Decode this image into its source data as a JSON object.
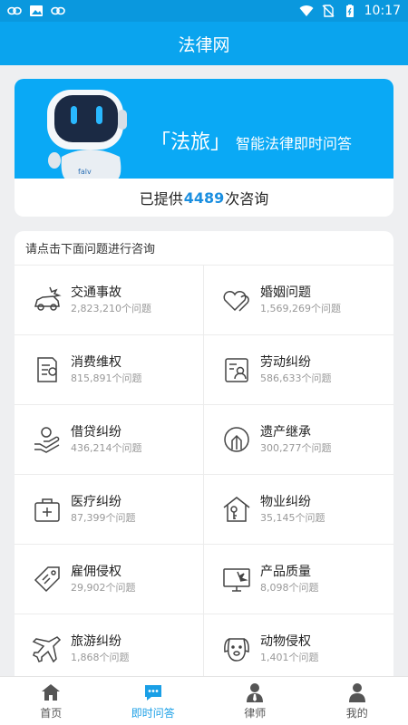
{
  "status_bar": {
    "time": "10:17"
  },
  "header": {
    "title": "法律网"
  },
  "banner": {
    "brand": "「法旅」",
    "slogan": "智能法律即时问答",
    "robot_tag": "falv"
  },
  "stats": {
    "prefix": "已提供",
    "count": "4489",
    "suffix": "次咨询"
  },
  "consult": {
    "title": "请点击下面问题进行咨询",
    "items": [
      {
        "name": "交通事故",
        "count": "2,823,210个问题",
        "icon": "car-accident-icon"
      },
      {
        "name": "婚姻问题",
        "count": "1,569,269个问题",
        "icon": "hearts-icon"
      },
      {
        "name": "消费维权",
        "count": "815,891个问题",
        "icon": "receipt-icon"
      },
      {
        "name": "劳动纠纷",
        "count": "586,633个问题",
        "icon": "id-card-icon"
      },
      {
        "name": "借贷纠纷",
        "count": "436,214个问题",
        "icon": "loan-hand-icon"
      },
      {
        "name": "遗产继承",
        "count": "300,277个问题",
        "icon": "inheritance-icon"
      },
      {
        "name": "医疗纠纷",
        "count": "87,399个问题",
        "icon": "medical-kit-icon"
      },
      {
        "name": "物业纠纷",
        "count": "35,145个问题",
        "icon": "house-key-icon"
      },
      {
        "name": "雇佣侵权",
        "count": "29,902个问题",
        "icon": "tag-icon"
      },
      {
        "name": "产品质量",
        "count": "8,098个问题",
        "icon": "broken-monitor-icon"
      },
      {
        "name": "旅游纠纷",
        "count": "1,868个问题",
        "icon": "airplane-icon"
      },
      {
        "name": "动物侵权",
        "count": "1,401个问题",
        "icon": "dog-icon"
      }
    ]
  },
  "nav": {
    "items": [
      {
        "label": "首页",
        "icon": "home-icon"
      },
      {
        "label": "即时问答",
        "icon": "chat-icon",
        "active": true
      },
      {
        "label": "律师",
        "icon": "lawyer-icon"
      },
      {
        "label": "我的",
        "icon": "profile-icon"
      }
    ]
  },
  "colors": {
    "primary": "#0aa4ee",
    "accent": "#1a9fe6",
    "count": "#1b8fe0"
  }
}
